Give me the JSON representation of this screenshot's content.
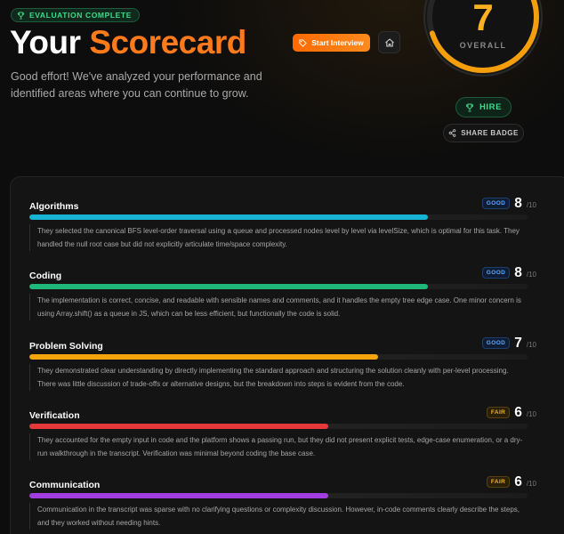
{
  "header": {
    "status_badge": "EVALUATION COMPLETE",
    "title_part1": "Your",
    "title_part2": "Scorecard",
    "subtitle": "Good effort! We've analyzed your performance and identified areas where you can continue to grow.",
    "start_interview_label": "Start Interview"
  },
  "overall": {
    "score": "7",
    "label": "OVERALL",
    "score_fraction": 0.7,
    "ring_color": "#f59e0b"
  },
  "verdict": {
    "label": "HIRE"
  },
  "share": {
    "label": "SHARE BADGE"
  },
  "icons": {
    "trophy": "trophy-icon",
    "start": "tag-icon",
    "home": "home-icon",
    "share": "share-icon"
  },
  "categories": [
    {
      "name": "Algorithms",
      "grade": "GOOD",
      "score": "8",
      "max": "/10",
      "fraction": 0.8,
      "color": "#17b3d4",
      "description": "They selected the canonical BFS level-order traversal using a queue and processed nodes level by level via levelSize, which is optimal for this task. They handled the null root case but did not explicitly articulate time/space complexity."
    },
    {
      "name": "Coding",
      "grade": "GOOD",
      "score": "8",
      "max": "/10",
      "fraction": 0.8,
      "color": "#1fb87a",
      "description": "The implementation is correct, concise, and readable with sensible names and comments, and it handles the empty tree edge case. One minor concern is using Array.shift() as a queue in JS, which can be less efficient, but functionally the code is solid."
    },
    {
      "name": "Problem Solving",
      "grade": "GOOD",
      "score": "7",
      "max": "/10",
      "fraction": 0.7,
      "color": "#f5a50b",
      "description": "They demonstrated clear understanding by directly implementing the standard approach and structuring the solution cleanly with per-level processing. There was little discussion of trade-offs or alternative designs, but the breakdown into steps is evident from the code."
    },
    {
      "name": "Verification",
      "grade": "FAIR",
      "score": "6",
      "max": "/10",
      "fraction": 0.6,
      "color": "#e5383b",
      "description": "They accounted for the empty input in code and the platform shows a passing run, but they did not present explicit tests, edge-case enumeration, or a dry-run walkthrough in the transcript. Verification was minimal beyond coding the base case."
    },
    {
      "name": "Communication",
      "grade": "FAIR",
      "score": "6",
      "max": "/10",
      "fraction": 0.6,
      "color": "#a23ee0",
      "description": "Communication in the transcript was sparse with no clarifying questions or complexity discussion. However, in-code comments clearly describe the steps, and they worked without needing hints."
    }
  ]
}
